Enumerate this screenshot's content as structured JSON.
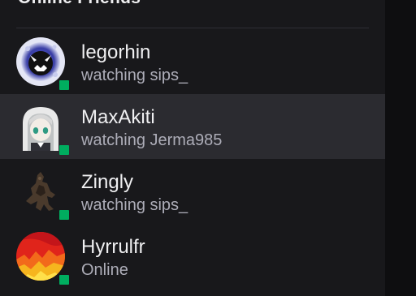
{
  "section": {
    "title": "Online Friends"
  },
  "friends": [
    {
      "name": "legorhin",
      "activity": "watching sips_",
      "status_color": "#00ad5f",
      "avatar": "monster-face-avatar",
      "highlighted": false
    },
    {
      "name": "MaxAkiti",
      "activity": "watching Jerma985",
      "status_color": "#00ad5f",
      "avatar": "anime-girl-avatar",
      "highlighted": true
    },
    {
      "name": "Zingly",
      "activity": "watching sips_",
      "status_color": "#00ad5f",
      "avatar": "dark-creature-avatar",
      "highlighted": false
    },
    {
      "name": "Hyrrulfr",
      "activity": "Online",
      "status_color": "#00ad5f",
      "avatar": "fire-avatar",
      "highlighted": false
    }
  ]
}
